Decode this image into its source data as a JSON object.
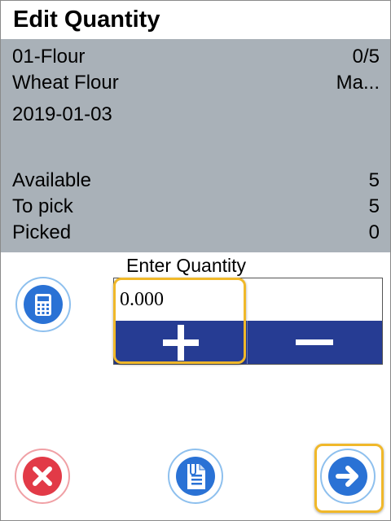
{
  "header": {
    "title": "Edit Quantity"
  },
  "item": {
    "code": "01-Flour",
    "progress": "0/5",
    "description": "Wheat Flour",
    "extra": "Ma...",
    "date": "2019-01-03"
  },
  "stats": [
    {
      "label": "Available",
      "value": "5"
    },
    {
      "label": "To pick",
      "value": "5"
    },
    {
      "label": "Picked",
      "value": "0"
    }
  ],
  "quantity": {
    "label": "Enter Quantity",
    "value": "0.000"
  },
  "icons": {
    "calculator": "calculator-icon",
    "cancel": "close-icon",
    "document": "attachment-document-icon",
    "next": "arrow-right-icon"
  },
  "colors": {
    "panel": "#a9b1b8",
    "stepper": "#263c93",
    "highlight": "#f0b82a",
    "cancel": "#e23a47",
    "action": "#2a72d5"
  }
}
